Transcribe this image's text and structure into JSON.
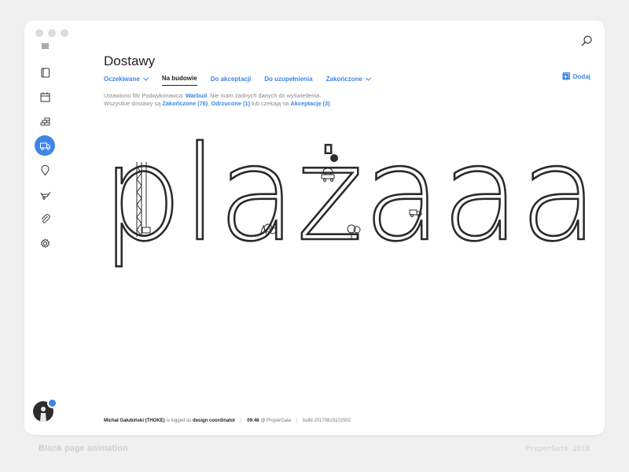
{
  "page": {
    "title": "Dostawy"
  },
  "tabs": [
    {
      "label": "Oczekiwane",
      "dropdown": true
    },
    {
      "label": "Na budowie",
      "active": true
    },
    {
      "label": "Do akceptacji"
    },
    {
      "label": "Do uzupełnienia"
    },
    {
      "label": "Zakończone",
      "dropdown": true
    }
  ],
  "actions": {
    "add_label": "Dodaj"
  },
  "info": {
    "line1_prefix": "Ustawiono filtr Podwykonawca: ",
    "line1_filter": "Warbud",
    "line1_suffix": ". Nie mam żadnych danych do wyświetlenia.",
    "line2_prefix": "Wszystkie dostawy są ",
    "link_completed": "Zakończone (78)",
    "sep1": ", ",
    "link_rejected": "Odrzucone (1)",
    "line2_mid": " lub czekają na ",
    "link_accept": "Akceptację (3)",
    "line2_suffix": "."
  },
  "art": {
    "text": "plażaaa"
  },
  "sidebar": {
    "items": [
      {
        "name": "menu",
        "icon": "hamburger-icon"
      },
      {
        "name": "book",
        "icon": "book-icon"
      },
      {
        "name": "calendar",
        "icon": "calendar-icon"
      },
      {
        "name": "bricks",
        "icon": "bricks-icon"
      },
      {
        "name": "deliveries",
        "icon": "truck-icon",
        "active": true
      },
      {
        "name": "location",
        "icon": "map-pin-icon"
      },
      {
        "name": "equipment",
        "icon": "wheelbarrow-icon"
      },
      {
        "name": "attachments",
        "icon": "paperclip-icon"
      },
      {
        "name": "settings",
        "icon": "gear-icon"
      }
    ]
  },
  "footer": {
    "user": "Michał Gałubiński (THOKE)",
    "logged_as": " is logged as ",
    "role": "design coordinator",
    "sep": "|",
    "time": "09:46",
    "company": " @ ProperGate",
    "build": "build 20170815102502"
  },
  "caption": {
    "left": "Blank page animation",
    "right": "ProperGate 2018"
  },
  "colors": {
    "accent": "#3f85e8",
    "background": "#f0f0f0",
    "window": "#ffffff",
    "text": "#222222"
  }
}
